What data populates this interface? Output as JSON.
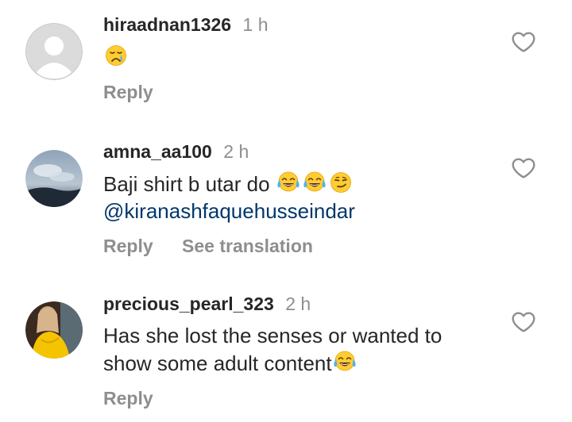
{
  "comments": [
    {
      "username": "hiraadnan1326",
      "time": "1 h",
      "text": "",
      "emojis": [
        "crying-face"
      ],
      "mention": "",
      "actions": {
        "reply": "Reply",
        "translate": ""
      }
    },
    {
      "username": "amna_aa100",
      "time": "2 h",
      "text": "Baji shirt b utar do ",
      "emojis": [
        "tears-of-joy",
        "tears-of-joy",
        "smirking-face"
      ],
      "mention": "@kiranashfaquehusseindar",
      "actions": {
        "reply": "Reply",
        "translate": "See translation"
      }
    },
    {
      "username": "precious_pearl_323",
      "time": "2 h",
      "text_line1": "Has she lost the senses or wanted to",
      "text_line2": "show some adult content",
      "emojis": [
        "tears-of-joy"
      ],
      "actions": {
        "reply": "Reply",
        "translate": ""
      }
    }
  ],
  "colors": {
    "username": "#262626",
    "secondary": "#8e8e8e",
    "mention": "#00376b",
    "background": "#ffffff"
  }
}
